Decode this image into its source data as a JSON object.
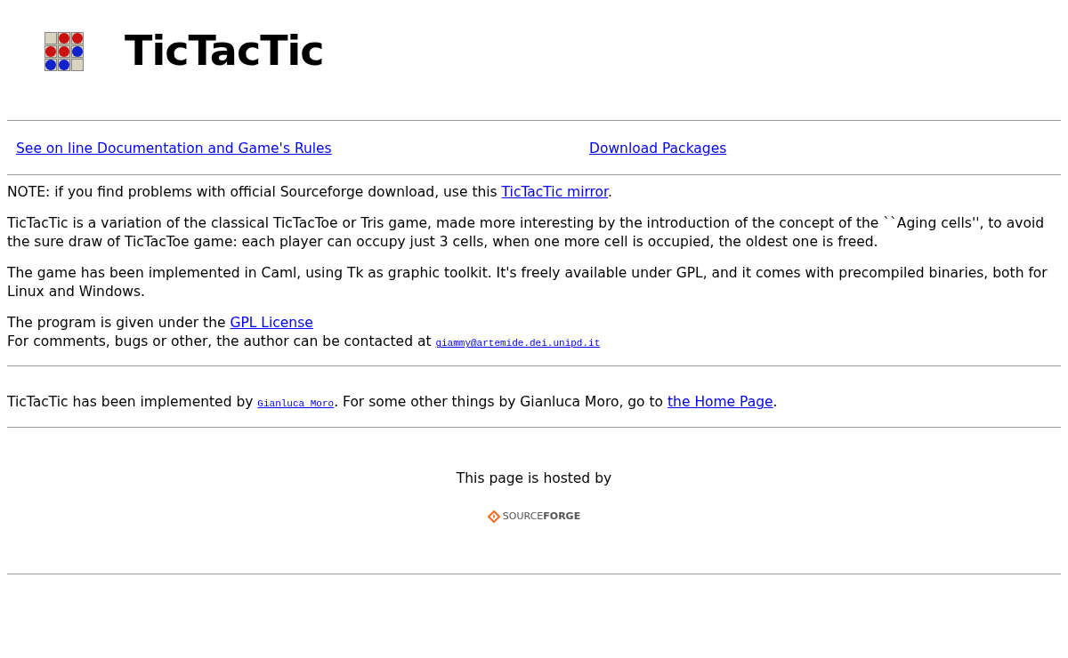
{
  "title": "TicTacTic",
  "nav_links": [
    "See on line Documentation and Game's Rules",
    "Download Packages"
  ],
  "paragraphs": [
    {
      "parts": [
        {
          "kind": "text",
          "text": "NOTE: if you find problems with official Sourceforge download, use this "
        },
        {
          "kind": "link",
          "text": "TicTacTic mirror"
        },
        {
          "kind": "text",
          "text": "."
        }
      ]
    },
    {
      "parts": [
        {
          "kind": "text",
          "text": "TicTacTic is a variation of the classical TicTacToe or Tris game, made more interesting by the introduction of the concept of the ``Aging cells'', to avoid the sure draw of TicTacToe game: each player can occupy just 3 cells, when one more cell is occupied, the oldest one is freed."
        }
      ]
    },
    {
      "parts": [
        {
          "kind": "text",
          "text": "The game has been implemented in Caml, using Tk as graphic toolkit. It's freely available under GPL, and it comes with precompiled binaries, both for Linux and Windows."
        }
      ]
    }
  ],
  "license_lines": [
    {
      "parts": [
        {
          "kind": "text",
          "text": "The program is given under the "
        },
        {
          "kind": "link",
          "text": "GPL License"
        }
      ]
    },
    {
      "parts": [
        {
          "kind": "text",
          "text": "For comments, bugs or other, the author can be contacted at "
        },
        {
          "kind": "codelink",
          "text": "giammy@artemide.dei.unipd.it"
        }
      ]
    }
  ],
  "author_line": {
    "parts": [
      {
        "kind": "text",
        "text": "TicTacTic has been implemented by "
      },
      {
        "kind": "codelink",
        "text": "Gianluca Moro"
      },
      {
        "kind": "text",
        "text": ". For some other things by Gianluca Moro, go to "
      },
      {
        "kind": "link",
        "text": "the Home Page"
      },
      {
        "kind": "text",
        "text": "."
      }
    ]
  },
  "hosted_text": "This page is hosted by",
  "host_logo": {
    "light": "SOURCE",
    "bold": "FORGE"
  }
}
